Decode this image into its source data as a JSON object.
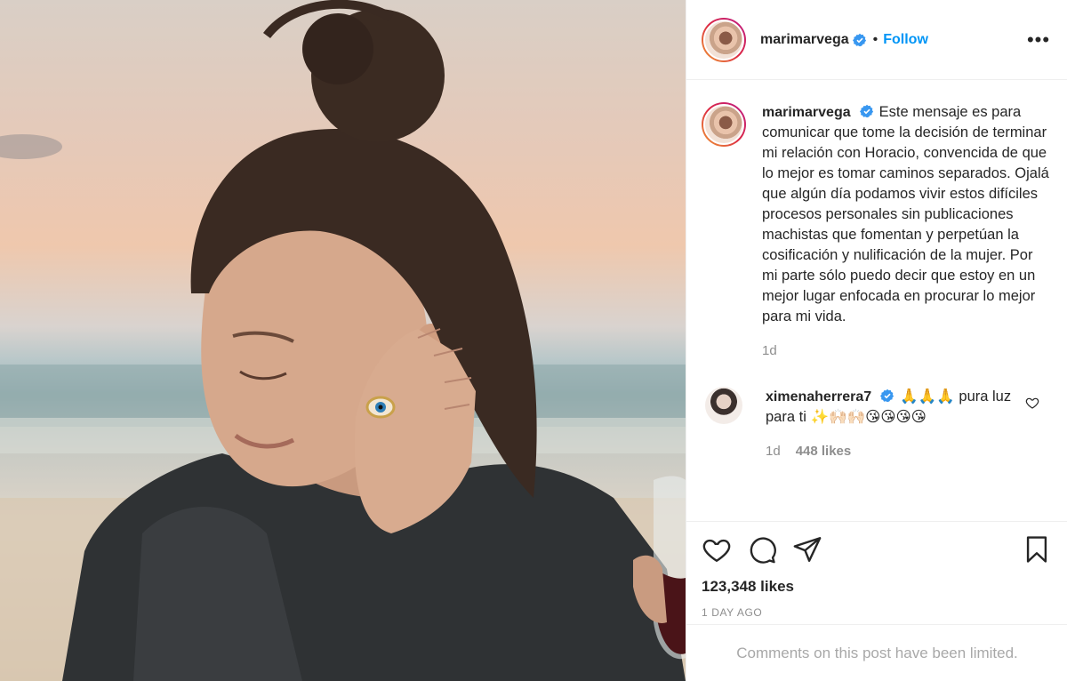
{
  "header": {
    "username": "marimarvega",
    "separator": "•",
    "follow_label": "Follow",
    "more_label": "•••"
  },
  "caption": {
    "username": "marimarvega",
    "text": "Este mensaje es para comunicar que tome la decisión de terminar mi relación con Horacio, convencida de que lo mejor es tomar caminos separados. Ojalá que algún día podamos vivir estos difíciles procesos personales sin publicaciones machistas que fomentan y perpetúan la cosificación y nulificación de la mujer. Por mi parte sólo puedo decir que estoy en un mejor lugar enfocada en procurar lo mejor para mi vida.",
    "age": "1d"
  },
  "comments": [
    {
      "username": "ximenaherrera7",
      "text": "🙏🙏🙏 pura luz para ti ✨🙌🏻🙌🏻😘😘😘😘",
      "age": "1d",
      "likes": "448 likes"
    }
  ],
  "actions": {
    "likes": "123,348 likes",
    "timestamp": "1 DAY AGO"
  },
  "comments_limited": "Comments on this post have been limited.",
  "icons": {
    "verified": "verified-badge-icon",
    "like": "heart-icon",
    "comment": "comment-bubble-icon",
    "share": "paper-plane-icon",
    "save": "bookmark-icon",
    "more": "more-dots-icon"
  },
  "colors": {
    "accent": "#0095f6",
    "text": "#262626",
    "secondary": "#8e8e8e",
    "border": "#efefef"
  }
}
